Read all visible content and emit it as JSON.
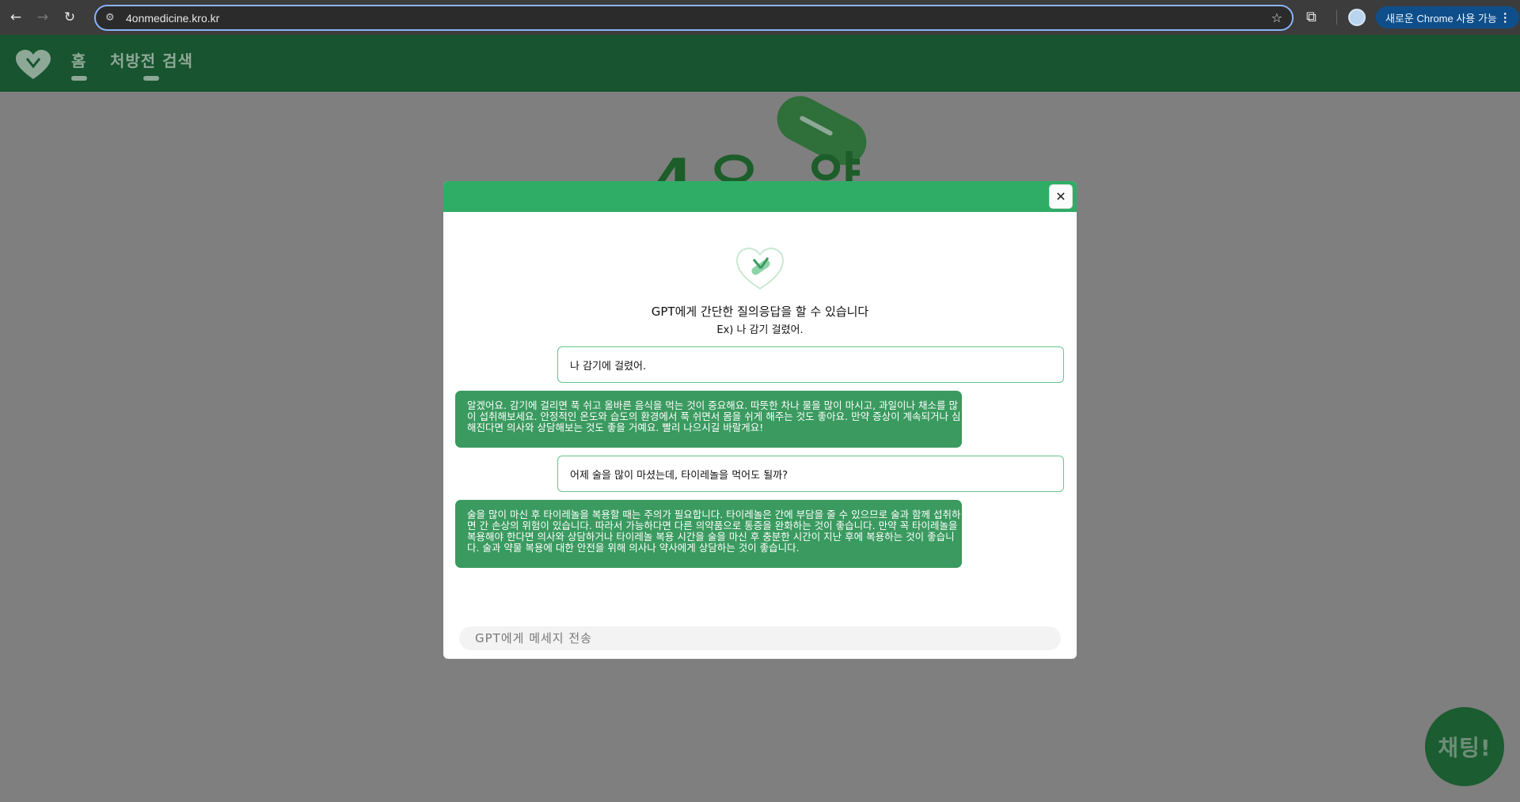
{
  "browser": {
    "url": "4onmedicine.kro.kr",
    "chrome_notice": "새로운 Chrome 사용 가능"
  },
  "site": {
    "nav": [
      {
        "label": "홈"
      },
      {
        "label": "처방전 검색"
      }
    ],
    "hero_text": "4오 약",
    "chat_fab_label": "채팅!"
  },
  "modal": {
    "close_label": "✕",
    "title": "GPT에게 간단한 질의응답을 할 수 있습니다",
    "example": "Ex) 나 감기 걸렸어.",
    "messages": [
      {
        "role": "user",
        "text": "나 감기에 걸렸어."
      },
      {
        "role": "assistant",
        "text": "알겠어요. 감기에 걸리면 푹 쉬고 올바른 음식을 먹는 것이 중요해요. 따뜻한 차나 물을 많이 마시고, 과일이나 채소를 많이 섭취해보세요. 안정적인 온도와 습도의 환경에서 푹 쉬면서 몸을 쉬게 해주는 것도 좋아요. 만약 증상이 계속되거나 심해진다면 의사와 상담해보는 것도 좋을 거예요. 빨리 나으시길 바랄게요!"
      },
      {
        "role": "user",
        "text": "어제 술을 많이 마셨는데, 타이레놀을 먹어도 될까?"
      },
      {
        "role": "assistant",
        "text": "술을 많이 마신 후 타이레놀을 복용할 때는 주의가 필요합니다. 타이레놀은 간에 부담을 줄 수 있으므로 술과 함께 섭취하면 간 손상의 위험이 있습니다. 따라서 가능하다면 다른 의약품으로 통증을 완화하는 것이 좋습니다. 만약 꼭 타이레놀을 복용해야 한다면 의사와 상담하거나 타이레놀 복용 시간을 술을 마신 후 충분한 시간이 지난 후에 복용하는 것이 좋습니다. 술과 약물 복용에 대한 안전을 위해 의사나 약사에게 상담하는 것이 좋습니다."
      }
    ],
    "input_placeholder": "GPT에게 메세지 전송"
  },
  "colors": {
    "modal_header": "#2fad66",
    "bot_bubble": "#3a9a5f",
    "user_border": "#63c78c",
    "site_header": "#17542f"
  }
}
